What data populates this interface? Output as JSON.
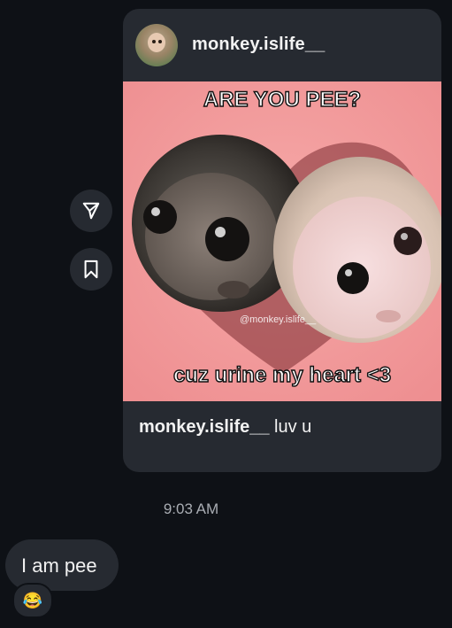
{
  "shared_post": {
    "username": "monkey.islife__",
    "meme_top_text": "ARE YOU PEE?",
    "meme_bottom_text": "cuz urine my heart <3",
    "watermark": "@monkey.islife__",
    "caption_username": "monkey.islife__",
    "caption_text": " luv u"
  },
  "actions": {
    "share_icon": "paper-plane-icon",
    "save_icon": "bookmark-icon"
  },
  "timestamp": "9:03 AM",
  "message": {
    "text": "I am pee",
    "reaction": "😂"
  }
}
